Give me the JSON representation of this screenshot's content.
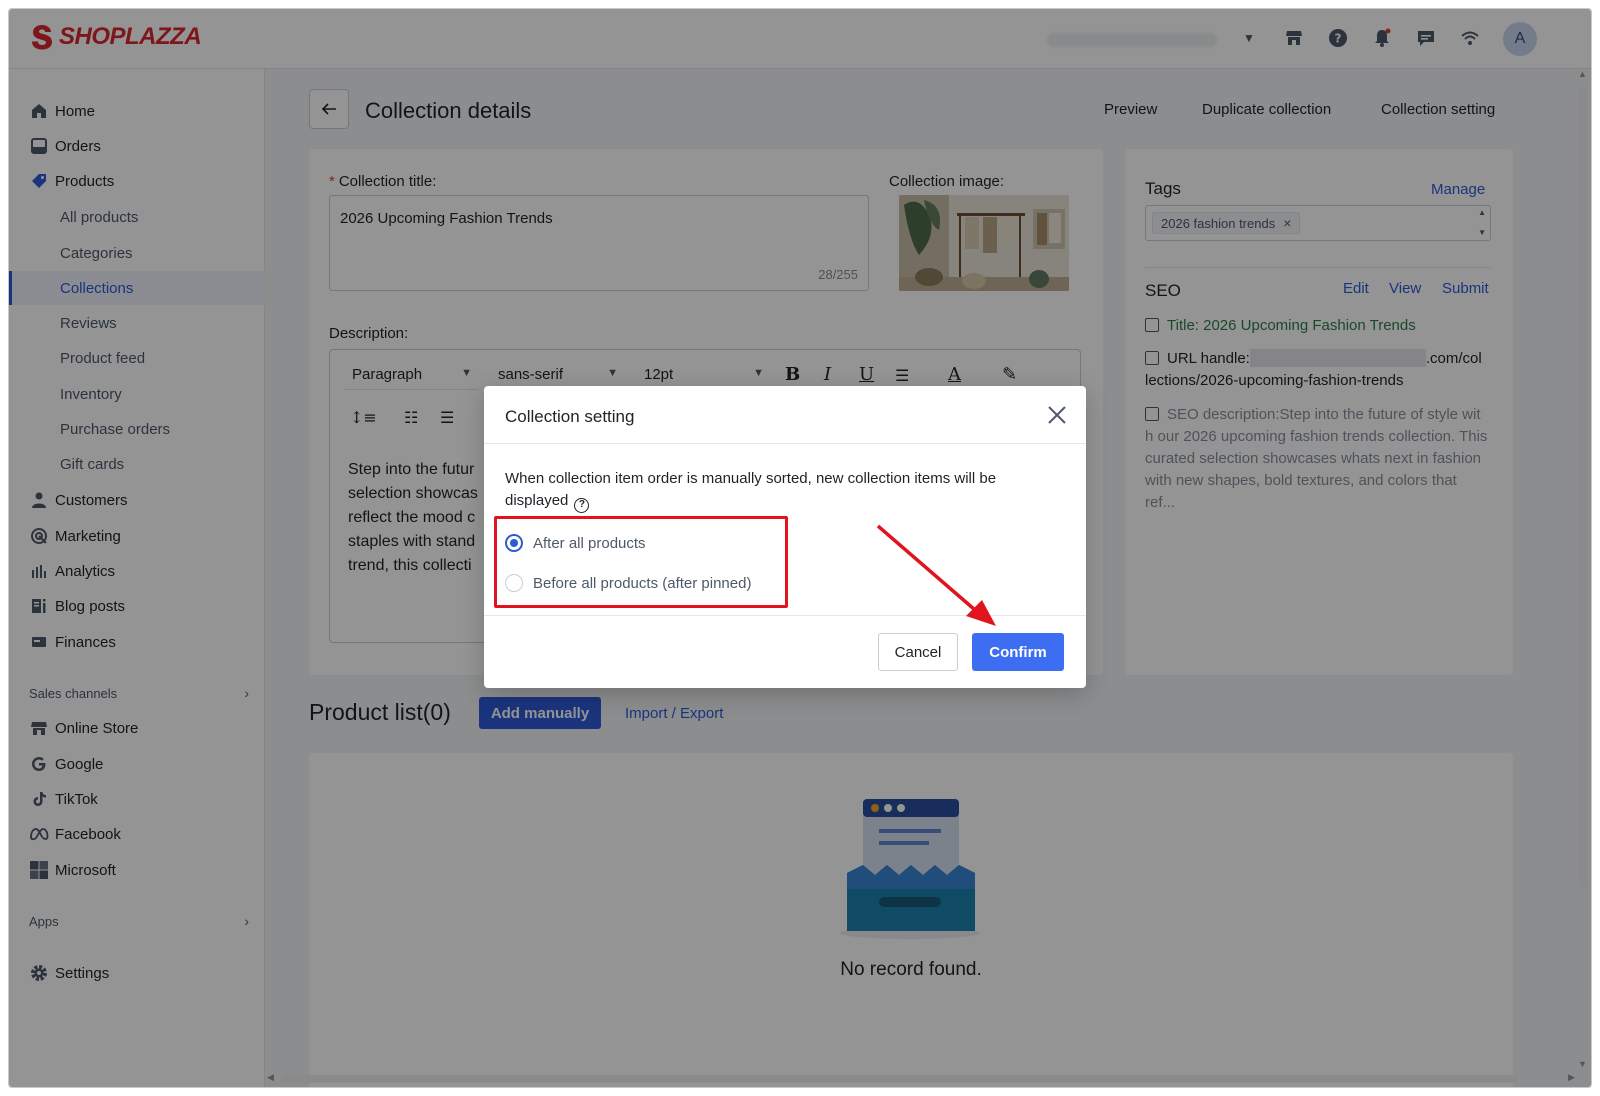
{
  "brand": {
    "name": "SHOPLAZZA",
    "color": "#d9282f"
  },
  "topbar": {
    "icons": [
      "store-icon",
      "help-icon",
      "bell-icon",
      "chat-icon",
      "wifi-icon"
    ],
    "avatar_initial": "A"
  },
  "sidebar": {
    "items": [
      {
        "label": "Home",
        "icon": "home-icon"
      },
      {
        "label": "Orders",
        "icon": "orders-icon"
      },
      {
        "label": "Products",
        "icon": "tag-icon"
      },
      {
        "label": "Customers",
        "icon": "user-icon"
      },
      {
        "label": "Marketing",
        "icon": "marketing-icon"
      },
      {
        "label": "Analytics",
        "icon": "analytics-icon"
      },
      {
        "label": "Blog posts",
        "icon": "blog-icon"
      },
      {
        "label": "Finances",
        "icon": "finances-icon"
      }
    ],
    "product_sub": [
      "All products",
      "Categories",
      "Collections",
      "Reviews",
      "Product feed",
      "Inventory",
      "Purchase orders",
      "Gift cards"
    ],
    "active_sub": "Collections",
    "sales_channels_label": "Sales channels",
    "channels": [
      {
        "label": "Online Store",
        "icon": "store-icon"
      },
      {
        "label": "Google",
        "icon": "google-icon"
      },
      {
        "label": "TikTok",
        "icon": "tiktok-icon"
      },
      {
        "label": "Facebook",
        "icon": "meta-icon"
      },
      {
        "label": "Microsoft",
        "icon": "microsoft-icon"
      }
    ],
    "apps_label": "Apps",
    "settings_label": "Settings"
  },
  "header": {
    "title": "Collection details",
    "actions": [
      "Preview",
      "Duplicate collection",
      "Collection setting"
    ]
  },
  "form": {
    "title_label": "Collection title:",
    "title_value": "2026 Upcoming Fashion Trends",
    "title_counter": "28/255",
    "image_label": "Collection image:",
    "description_label": "Description:",
    "toolbar": {
      "block": "Paragraph",
      "font": "sans-serif",
      "size": "12pt"
    },
    "description_lines": [
      "Step into the futur",
      "selection showcas",
      "reflect the mood c",
      "staples with stand",
      "trend, this collecti"
    ]
  },
  "tags": {
    "heading": "Tags",
    "manage": "Manage",
    "chip": "2026 fashion trends"
  },
  "seo": {
    "heading": "SEO",
    "links": [
      "Edit",
      "View",
      "Submit"
    ],
    "title_line": "Title: 2026 Upcoming Fashion Trends",
    "url_prefix": "URL handle:",
    "url_suffix": ".com/col",
    "url_line2": "lections/2026-upcoming-fashion-trends",
    "description": "SEO description:Step into the future of style wit h our 2026 upcoming fashion trends collection. This curated selection showcases whats next in fashion with new shapes, bold textures, and colors that ref..."
  },
  "product_list": {
    "title": "Product list(0)",
    "add_button": "Add manually",
    "import_link": "Import / Export",
    "empty_text": "No record found."
  },
  "modal": {
    "title": "Collection setting",
    "description": "When collection item order is manually sorted, new collection items will be displayed",
    "options": [
      "After all products",
      "Before all products (after pinned)"
    ],
    "selected_index": 0,
    "cancel": "Cancel",
    "confirm": "Confirm",
    "accent": "#3d6ef2",
    "highlight_color": "#e0141e"
  }
}
